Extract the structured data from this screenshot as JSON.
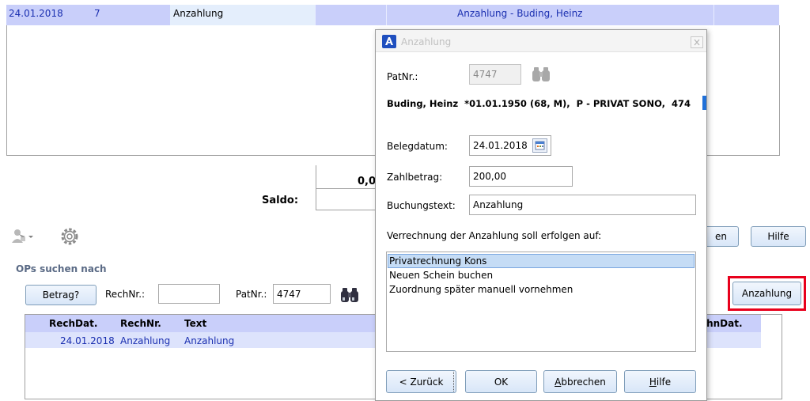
{
  "top_row": {
    "date": "24.01.2018",
    "num": "7",
    "type": "Anzahlung",
    "description": "Anzahlung - Buding, Heinz"
  },
  "summary": {
    "value": "0,0",
    "saldo_label": "Saldo:"
  },
  "bg_buttons": {
    "partial_label": "en",
    "hilfe_label": "Hilfe",
    "anzahlung_label": "Anzahlung"
  },
  "search": {
    "section_label": "OPs suchen nach",
    "betrag_button": "Betrag?",
    "rechnr_label": "RechNr.:",
    "rechnr_value": "",
    "patnr_label": "PatNr.:",
    "patnr_value": "4747"
  },
  "results_table": {
    "headers": [
      "RechDat.",
      "RechNr.",
      "Text",
      "ahnDat."
    ],
    "rows": [
      {
        "date": "24.01.2018",
        "rechnr": "Anzahlung",
        "text": "Anzahlung"
      }
    ]
  },
  "dialog": {
    "title": "Anzahlung",
    "patnr_label": "PatNr.:",
    "patnr_value": "4747",
    "patient_info": "Buding, Heinz  *01.01.1950 (68, M),  P - PRIVAT SONO,  474",
    "belegdatum_label": "Belegdatum:",
    "belegdatum_value": "24.01.2018",
    "zahlbetrag_label": "Zahlbetrag:",
    "zahlbetrag_value": "200,00",
    "buchungstext_label": "Buchungstext:",
    "buchungstext_value": "Anzahlung",
    "verrechnung_label": "Verrechnung der Anzahlung soll erfolgen auf:",
    "options": [
      "Privatrechnung Kons",
      "Neuen Schein buchen",
      "Zuordnung später manuell vornehmen"
    ],
    "selected_option_index": 0,
    "buttons": {
      "back": "< Zurück",
      "ok": "OK",
      "cancel": "Abbrechen",
      "help": "Hilfe"
    }
  },
  "colors": {
    "row_highlight": "#c9cffa",
    "row_text_blue": "#1a2fb0",
    "list_selected": "#c5dcf5",
    "highlight_box": "#e8001c",
    "dialog_title_bg": "#f4f4f4"
  }
}
